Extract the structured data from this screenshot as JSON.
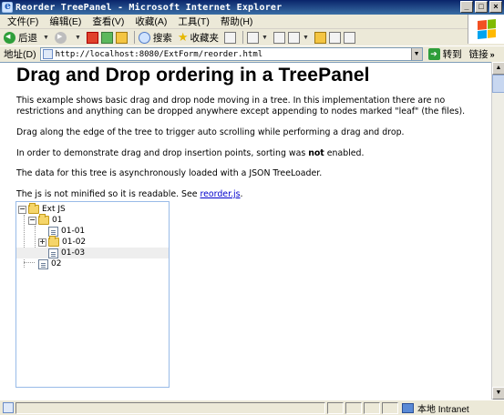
{
  "window": {
    "title": "Reorder TreePanel - Microsoft Internet Explorer",
    "buttons": [
      "_",
      "□",
      "×"
    ]
  },
  "menu": [
    "文件(F)",
    "编辑(E)",
    "查看(V)",
    "收藏(A)",
    "工具(T)",
    "帮助(H)"
  ],
  "toolbar": {
    "back": "后退",
    "search": "搜索",
    "favorites": "收藏夹"
  },
  "address": {
    "label": "地址(D)",
    "url": "http://localhost:8080/ExtForm/reorder.html",
    "go": "转到",
    "links": "链接"
  },
  "page": {
    "heading": "Drag and Drop ordering in a TreePanel",
    "p1": "This example shows basic drag and drop node moving in a tree. In this implementation there are no restrictions and anything can be dropped anywhere except appending to nodes marked \"leaf\" (the files).",
    "p2": "Drag along the edge of the tree to trigger auto scrolling while performing a drag and drop.",
    "p3_pre": "In order to demonstrate drag and drop insertion points, sorting was ",
    "p3_bold": "not",
    "p3_post": " enabled.",
    "p4": "The data for this tree is asynchronously loaded with a JSON TreeLoader.",
    "p5_pre": "The js is not minified so it is readable. See ",
    "p5_link": "reorder.js",
    "p5_post": "."
  },
  "tree": {
    "root": "Ext JS",
    "n01": "01",
    "n0101": "01-01",
    "n0102": "01-02",
    "n0103": "01-03",
    "n02": "02"
  },
  "status": {
    "zone": "本地 Intranet"
  }
}
